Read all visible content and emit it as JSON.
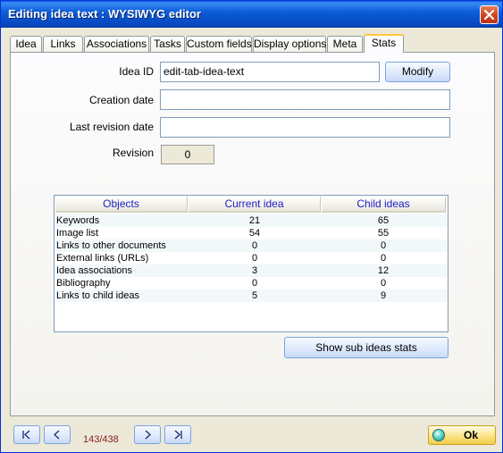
{
  "window": {
    "title": "Editing idea text : WYSIWYG editor"
  },
  "tabs": [
    {
      "label": "Idea"
    },
    {
      "label": "Links"
    },
    {
      "label": "Associations"
    },
    {
      "label": "Tasks"
    },
    {
      "label": "Custom fields"
    },
    {
      "label": "Display options"
    },
    {
      "label": "Meta"
    },
    {
      "label": "Stats"
    }
  ],
  "active_tab": "Stats",
  "form": {
    "idea_id_label": "Idea ID",
    "idea_id_value": "edit-tab-idea-text",
    "modify_label": "Modify",
    "creation_date_label": "Creation date",
    "creation_date_value": "",
    "last_revision_label": "Last revision date",
    "last_revision_value": "",
    "revision_label": "Revision",
    "revision_value": "0"
  },
  "stats": {
    "columns": [
      "Objects",
      "Current idea",
      "Child ideas"
    ],
    "rows": [
      {
        "object": "Keywords",
        "current": "21",
        "child": "65"
      },
      {
        "object": "Image list",
        "current": "54",
        "child": "55"
      },
      {
        "object": "Links to other documents",
        "current": "0",
        "child": "0"
      },
      {
        "object": "External links (URLs)",
        "current": "0",
        "child": "0"
      },
      {
        "object": "Idea associations",
        "current": "3",
        "child": "12"
      },
      {
        "object": "Bibliography",
        "current": "0",
        "child": "0"
      },
      {
        "object": "Links to child ideas",
        "current": "5",
        "child": "9"
      }
    ],
    "show_sub_label": "Show sub ideas stats"
  },
  "footer": {
    "counter": "143/438",
    "ok_label": "Ok",
    "nav_icons": [
      "first-icon",
      "prev-icon",
      "next-icon",
      "last-icon"
    ]
  },
  "colors": {
    "titlebar": "#0B5ED8",
    "active_tab_accent": "#FFC83C",
    "header_text": "#1C1CC8",
    "counter_text": "#8B1A1A",
    "ok_button": "#FBE48A"
  }
}
